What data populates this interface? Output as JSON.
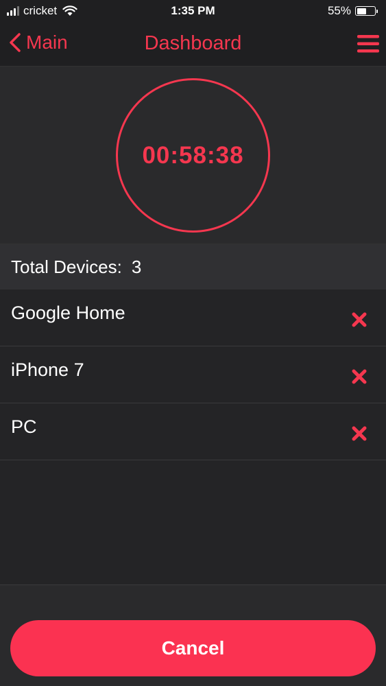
{
  "status_bar": {
    "carrier": "cricket",
    "time": "1:35 PM",
    "battery_percent": "55%",
    "battery_level": 0.55,
    "signal_bars_total": 4,
    "signal_bars_active": 3,
    "wifi_icon": "wifi-icon"
  },
  "nav": {
    "back_label": "Main",
    "back_icon": "chevron-left-icon",
    "title": "Dashboard",
    "menu_icon": "hamburger-menu-icon"
  },
  "timer": {
    "value": "00:58:38"
  },
  "devices": {
    "total_label": "Total Devices:",
    "total_count": "3",
    "items": [
      {
        "name": "Google Home",
        "remove_icon": "close-x-icon"
      },
      {
        "name": "iPhone 7",
        "remove_icon": "close-x-icon"
      },
      {
        "name": "PC",
        "remove_icon": "close-x-icon"
      }
    ]
  },
  "footer": {
    "cancel_label": "Cancel"
  },
  "colors": {
    "accent": "#f5374f",
    "button": "#fb3251",
    "background": "#2a2a2c",
    "nav_background": "#1f1f21",
    "list_background": "#242426"
  }
}
